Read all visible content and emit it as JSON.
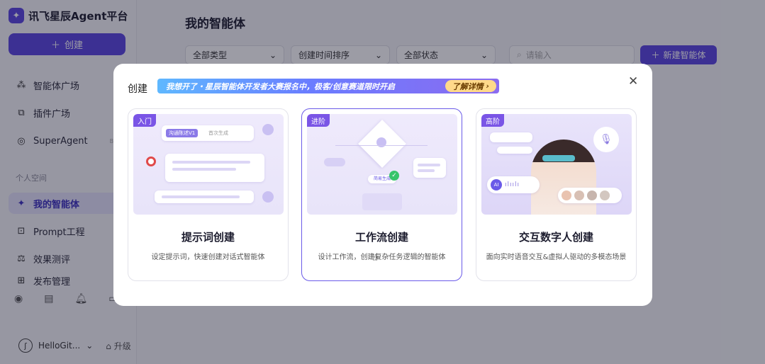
{
  "app": {
    "title": "讯飞星辰Agent平台",
    "logo_glyph": "✦"
  },
  "sidebar": {
    "create_label": "创建",
    "items": [
      {
        "label": "智能体广场",
        "icon": "grid-icon",
        "glyph": "⁂"
      },
      {
        "label": "插件广场",
        "icon": "puzzle-icon",
        "glyph": "⧉"
      },
      {
        "label": "SuperAgent",
        "icon": "superagent-icon",
        "glyph": "◎",
        "badge": "BETA"
      }
    ],
    "section_label": "个人空间",
    "personal_items": [
      {
        "label": "我的智能体",
        "icon": "sparkle-icon",
        "glyph": "✦",
        "active": true
      },
      {
        "label": "Prompt工程",
        "icon": "prompt-icon",
        "glyph": "⊡"
      },
      {
        "label": "效果测评",
        "icon": "evaluate-icon",
        "glyph": "⚖"
      },
      {
        "label": "发布管理",
        "icon": "publish-icon",
        "glyph": "⊞"
      }
    ],
    "user_name": "HelloGit...",
    "upgrade_label": "升级"
  },
  "main": {
    "title": "我的智能体",
    "filters": [
      {
        "value": "全部类型"
      },
      {
        "value": "创建时间排序"
      },
      {
        "value": "全部状态"
      }
    ],
    "search_placeholder": "请输入",
    "new_agent_label": "新建智能体"
  },
  "modal": {
    "title": "创建",
    "banner_text": "我想开了・星辰智能体开发者大赛报名中，极客/创意赛道限时开启",
    "banner_button": "了解详情",
    "cards": [
      {
        "tag": "入门",
        "title": "提示词创建",
        "desc": "设定提示词，快速创建对话式智能体",
        "thumb_chip1": "沟通陈述V1",
        "thumb_chip2": "首次生成"
      },
      {
        "tag": "进阶",
        "title": "工作流创建",
        "desc": "设计工作流，创建复杂任务逻辑的智能体",
        "thumb_chip": "简易生成"
      },
      {
        "tag": "高阶",
        "title": "交互数字人创建",
        "desc": "面向实时语音交互&虚拟人驱动的多模态场景",
        "thumb_ai": "AI"
      }
    ]
  },
  "colors": {
    "accent": "#5b46e0",
    "tag": "#7a55e6",
    "active_bg": "#e6e3fb"
  }
}
